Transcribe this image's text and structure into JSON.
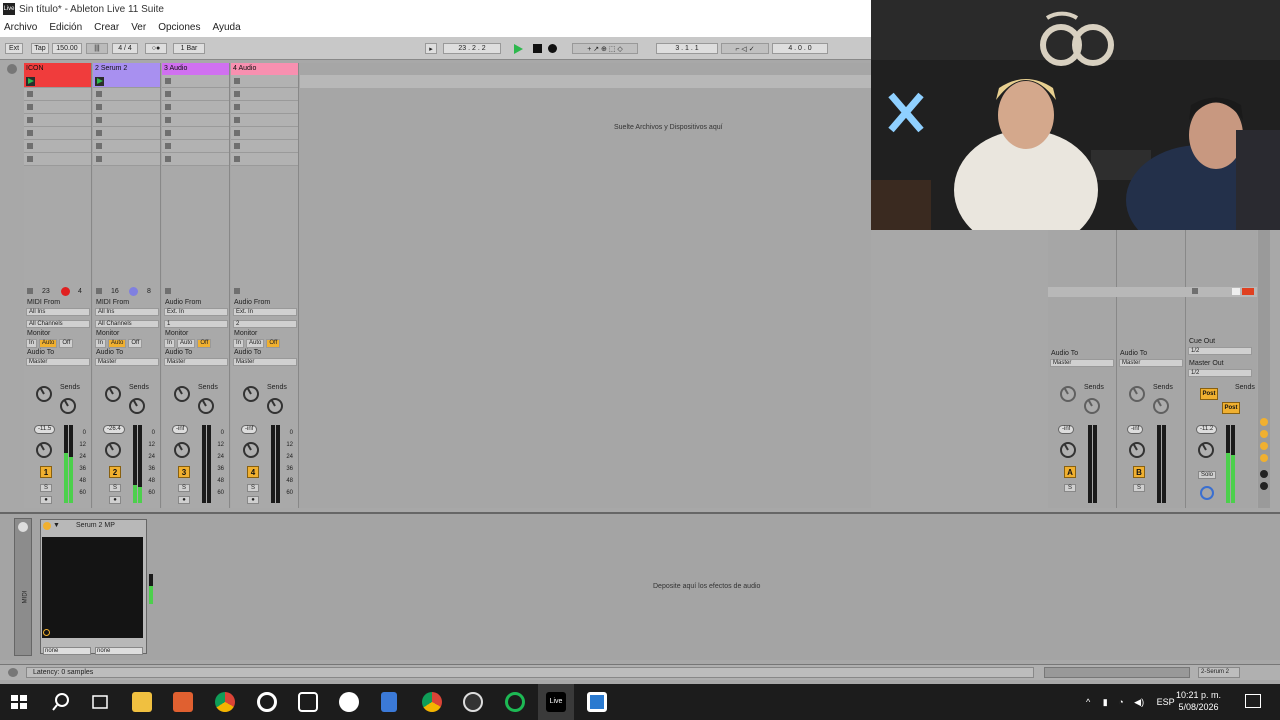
{
  "window": {
    "title": "Sin título* - Ableton Live 11 Suite",
    "app_icon": "Live"
  },
  "menu": [
    "Archivo",
    "Edición",
    "Crear",
    "Ver",
    "Opciones",
    "Ayuda"
  ],
  "transport": {
    "ext": "Ext",
    "tap": "Tap",
    "tempo": "150.00",
    "meter": "4 / 4",
    "quantize": "1 Bar",
    "position": "23 . 2 . 2",
    "loop_start": "3 . 1 . 1",
    "loop_length": "4 . 0 . 0"
  },
  "tracks": [
    {
      "name": "ICON",
      "color": "#f03c3c",
      "slots_filled": 1,
      "slot_color": "#f03c3c",
      "input_label": "MIDI From",
      "input": "All Ins",
      "channel": "All Channels",
      "monitor_label": "Monitor",
      "monitor": [
        "In",
        "Auto",
        "Off"
      ],
      "out_label": "Audio To",
      "out": "Master",
      "sends": "Sends",
      "vol": "-11.5",
      "num": "1",
      "bar_l": "23",
      "bar_r": "4"
    },
    {
      "name": "2 Serum 2",
      "color": "#a890f0",
      "slots_filled": 1,
      "slot_color": "#a890f0",
      "input_label": "MIDI From",
      "input": "All Ins",
      "channel": "All Channels",
      "monitor_label": "Monitor",
      "monitor": [
        "In",
        "Auto",
        "Off"
      ],
      "out_label": "Audio To",
      "out": "Master",
      "sends": "Sends",
      "vol": "-26.4",
      "num": "2",
      "bar_l": "16",
      "bar_r": "8"
    },
    {
      "name": "3 Audio",
      "color": "#d070f0",
      "slots_filled": 0,
      "slot_color": "",
      "input_label": "Audio From",
      "input": "Ext. In",
      "channel": "1",
      "monitor_label": "Monitor",
      "monitor": [
        "In",
        "Auto",
        "Off"
      ],
      "out_label": "Audio To",
      "out": "Master",
      "sends": "Sends",
      "vol": "-inf",
      "num": "3",
      "bar_l": "",
      "bar_r": ""
    },
    {
      "name": "4 Audio",
      "color": "#f890b0",
      "slots_filled": 0,
      "slot_color": "",
      "input_label": "Audio From",
      "input": "Ext. In",
      "channel": "2",
      "monitor_label": "Monitor",
      "monitor": [
        "In",
        "Auto",
        "Off"
      ],
      "out_label": "Audio To",
      "out": "Master",
      "sends": "Sends",
      "vol": "-inf",
      "num": "4",
      "bar_l": "",
      "bar_r": ""
    }
  ],
  "drop_files": "Suelte Archivos y Dispositivos aquí",
  "returns": [
    {
      "out_label": "Audio To",
      "out": "Master",
      "sends": "Sends",
      "vol": "-inf",
      "letter": "A"
    },
    {
      "out_label": "Audio To",
      "out": "Master",
      "sends": "Sends",
      "vol": "-inf",
      "letter": "B"
    }
  ],
  "master": {
    "cue_label": "Cue Out",
    "cue": "1/2",
    "out_label": "Master Out",
    "out": "1/2",
    "sends": "Sends",
    "post": "Post",
    "vol": "-11.2",
    "solo": "Solo"
  },
  "meter_scale": [
    "0",
    "12",
    "24",
    "36",
    "48",
    "60"
  ],
  "device": {
    "name": "Serum 2 MP",
    "sel1": "none",
    "sel2": "none",
    "side_label": "MIDI"
  },
  "drop_fx": "Deposite aquí los efectos de audio",
  "status": {
    "latency": "Latency: 0 samples",
    "track": "2-Serum 2"
  },
  "tray": {
    "lang": "ESP",
    "time": "10:21 p. m.",
    "date": "5/08/2026"
  },
  "icons": [
    "windows-start-icon",
    "search-icon",
    "task-view-icon",
    "file-explorer-icon",
    "media-player-icon",
    "chrome-icon",
    "settings-gear-icon",
    "box-icon",
    "compass-icon",
    "document-icon",
    "chrome-icon-2",
    "obs-icon",
    "xbox-icon",
    "ableton-live-icon",
    "notepad-icon"
  ]
}
